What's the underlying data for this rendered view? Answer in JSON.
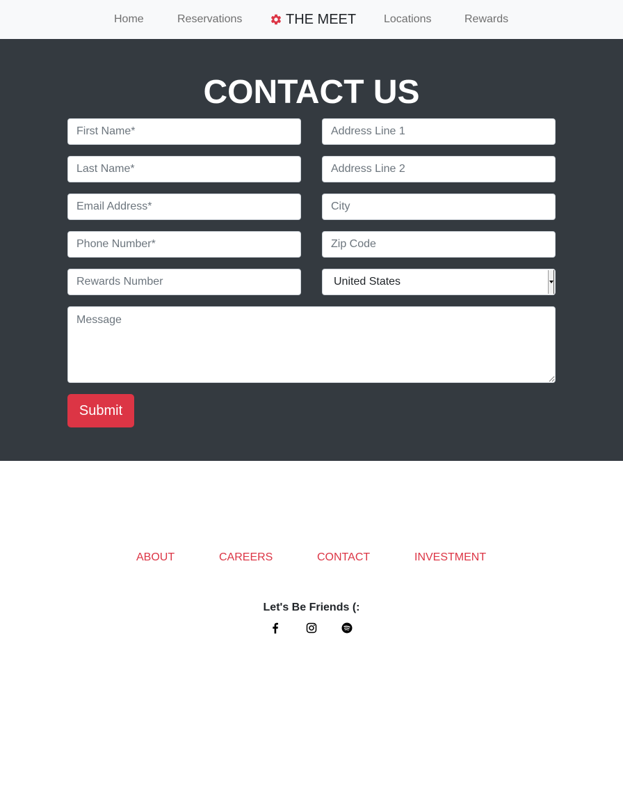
{
  "nav": {
    "links": [
      "Home",
      "Reservations",
      "Locations",
      "Rewards"
    ],
    "brand": "THE MEET",
    "brand_icon": "gear-icon",
    "brand_icon_color": "#dc3545"
  },
  "contact": {
    "title": "CONTACT US",
    "fields_left": [
      {
        "placeholder": "First Name*"
      },
      {
        "placeholder": "Last Name*"
      },
      {
        "placeholder": "Email Address*"
      },
      {
        "placeholder": "Phone Number*"
      },
      {
        "placeholder": "Rewards Number"
      }
    ],
    "fields_right": [
      {
        "placeholder": "Address Line 1"
      },
      {
        "placeholder": "Address Line 2"
      },
      {
        "placeholder": "City"
      },
      {
        "placeholder": "Zip Code"
      }
    ],
    "country_selected": "United States",
    "message_placeholder": "Message",
    "submit_label": "Submit",
    "background_color": "#343a40",
    "accent_color": "#dc3545"
  },
  "footer": {
    "links": [
      "ABOUT",
      "CAREERS",
      "CONTACT",
      "INVESTMENT"
    ],
    "friends_text": "Let's Be Friends (:",
    "social_icons": [
      "facebook-icon",
      "instagram-icon",
      "spotify-icon"
    ],
    "link_color": "#dc3545"
  }
}
